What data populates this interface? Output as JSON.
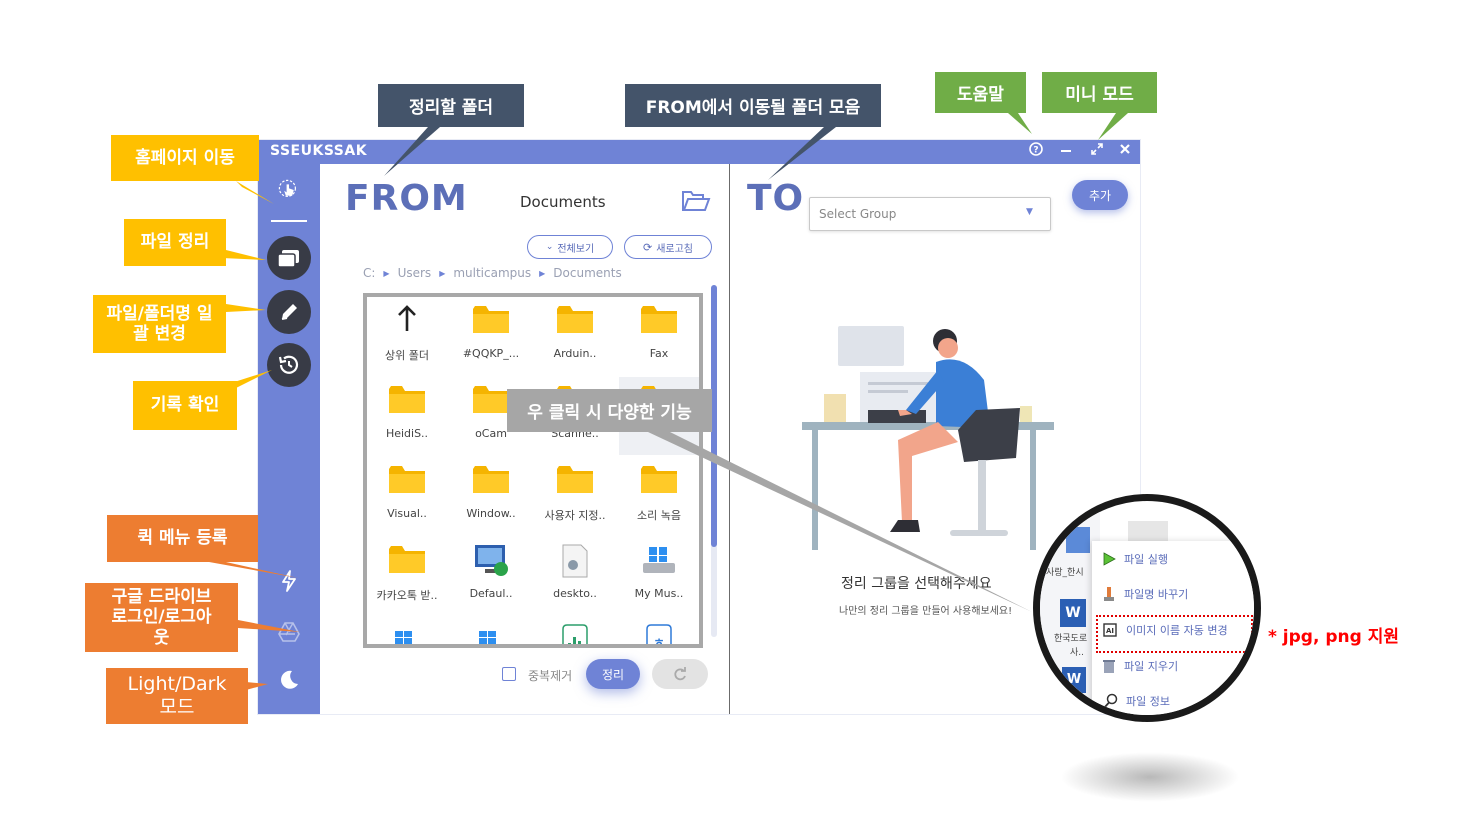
{
  "app": {
    "title": "SSEUKSSAK",
    "window_controls": [
      "help-icon",
      "minimize-icon",
      "mini-mode-icon",
      "close-icon"
    ]
  },
  "colors": {
    "accent": "#6f83d6",
    "sidebar_button": "#383b46",
    "callout_yellow": "#ffc000",
    "callout_orange": "#ed7d31",
    "callout_navy": "#44546a",
    "callout_green": "#70ad47",
    "red_note": "#ff0000"
  },
  "from_panel": {
    "heading": "FROM",
    "folder_name": "Documents",
    "view_all": "전체보기",
    "refresh": "새로고침",
    "breadcrumb": [
      "C:",
      "Users",
      "multicampus",
      "Documents"
    ],
    "items": [
      {
        "label": "상위 폴더",
        "icon": "up-arrow-icon"
      },
      {
        "label": "#QQKP_...",
        "icon": "folder-icon"
      },
      {
        "label": "Arduin..",
        "icon": "folder-icon"
      },
      {
        "label": "Fax",
        "icon": "folder-icon"
      },
      {
        "label": "HeidiS..",
        "icon": "folder-icon"
      },
      {
        "label": "oCam",
        "icon": "folder-icon"
      },
      {
        "label": "Scanne..",
        "icon": "folder-icon"
      },
      {
        "label": "",
        "icon": "folder-icon"
      },
      {
        "label": "Visual..",
        "icon": "folder-icon"
      },
      {
        "label": "Window..",
        "icon": "folder-icon"
      },
      {
        "label": "사용자 지정..",
        "icon": "folder-icon"
      },
      {
        "label": "소리 녹음",
        "icon": "folder-icon"
      },
      {
        "label": "카카오톡 받..",
        "icon": "folder-icon"
      },
      {
        "label": "Defaul..",
        "icon": "remote-desktop-icon"
      },
      {
        "label": "deskto..",
        "icon": "settings-file-icon"
      },
      {
        "label": "My Mus..",
        "icon": "drive-icon"
      },
      {
        "label": "",
        "icon": "windows-icon"
      },
      {
        "label": "",
        "icon": "windows-icon"
      },
      {
        "label": "",
        "icon": "chart-file-icon"
      },
      {
        "label": "",
        "icon": "hangul-file-icon"
      }
    ],
    "dedupe_label": "중복제거",
    "organize_button": "정리"
  },
  "to_panel": {
    "heading": "TO",
    "select_placeholder": "Select Group",
    "add_button": "추가",
    "empty_title": "정리 그룹을 선택해주세요",
    "empty_subtitle": "나만의 정리 그룹을 만들어 사용해보세요!"
  },
  "context_menu": {
    "items": [
      {
        "label": "파일 실행",
        "icon": "play-icon"
      },
      {
        "label": "파일명 바꾸기",
        "icon": "rename-icon"
      },
      {
        "label": "이미지 이름 자동 변경",
        "icon": "ai-chip-icon"
      },
      {
        "label": "파일 지우기",
        "icon": "trash-icon"
      },
      {
        "label": "파일 정보",
        "icon": "magnifier-icon"
      }
    ],
    "peek_texts": [
      "사랑_한시",
      "한국도로",
      "사.."
    ]
  },
  "callouts": {
    "homepage": "홈페이지 이동",
    "file_organize": "파일 정리",
    "rename": "파일/폴더명 일괄 변경",
    "history": "기록 확인",
    "quick_menu": "퀵 메뉴 등록",
    "google_drive": "구글 드라이브 로그인/로그아웃",
    "theme": "Light/Dark 모드",
    "source_folder": "정리할 폴더",
    "dest_folders": "FROM에서 이동될 폴더 모음",
    "help": "도움말",
    "mini_mode": "미니 모드",
    "right_click": "우 클릭 시 다양한 기능",
    "format_note": "* jpg, png 지원"
  }
}
